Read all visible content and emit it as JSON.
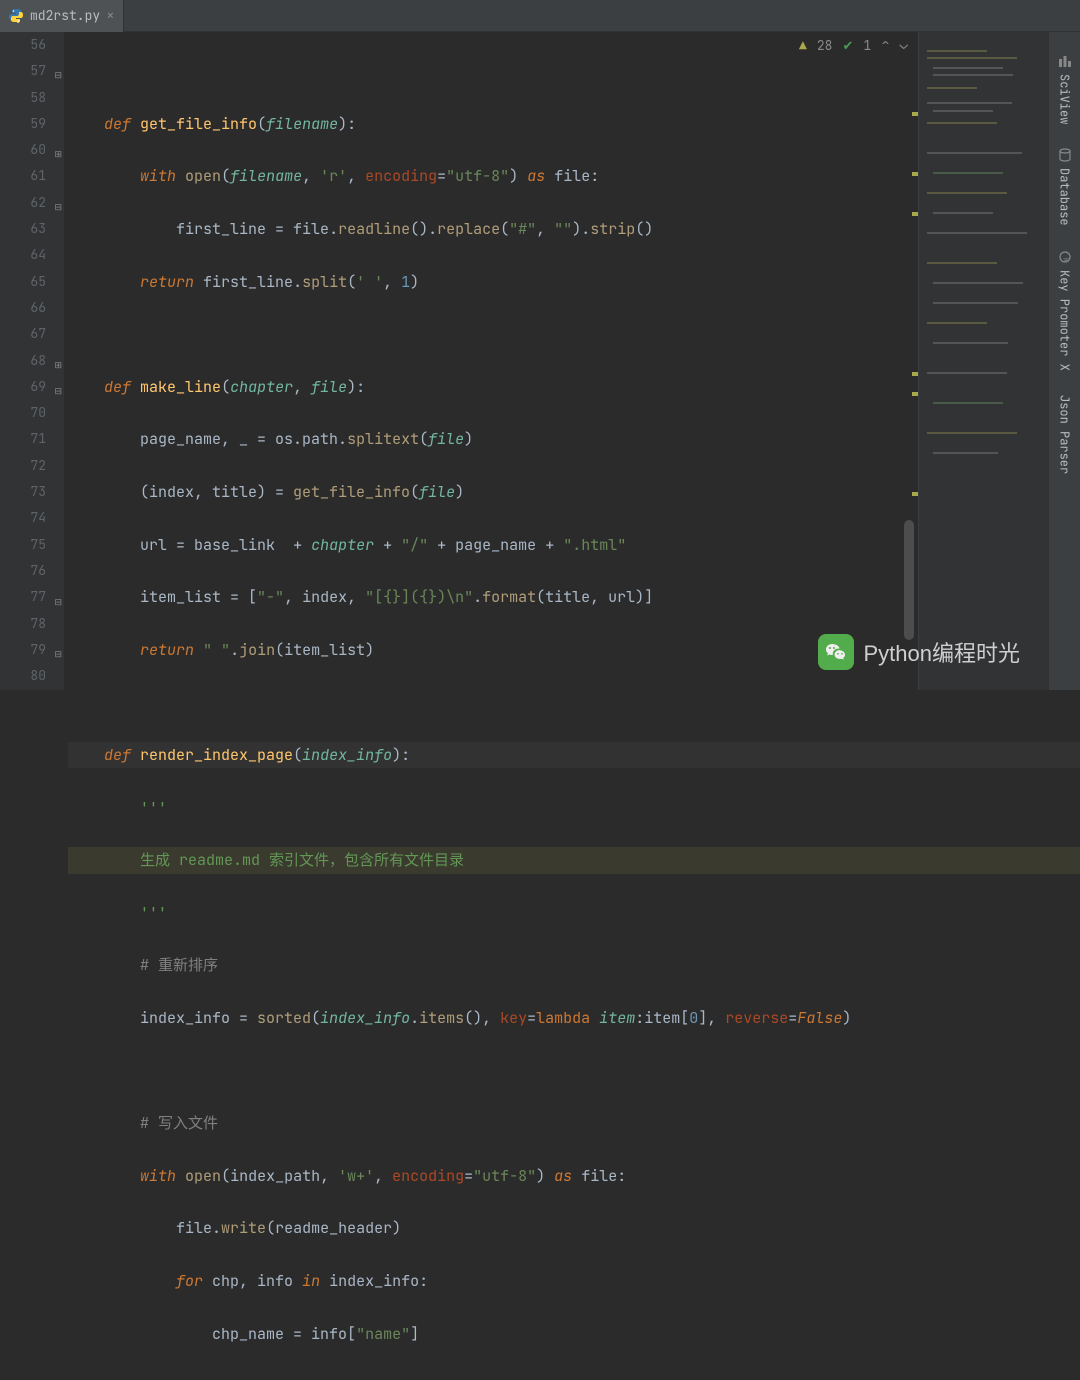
{
  "tab": {
    "filename": "md2rst.py",
    "close": "×"
  },
  "inspections": {
    "warnings": "28",
    "passes": "1"
  },
  "tools": {
    "sciview": "SciView",
    "database": "Database",
    "keypromoter": "Key Promoter X",
    "jsonparser": "Json Parser"
  },
  "watermark": "Python编程时光",
  "gutter": [
    "56",
    "57",
    "58",
    "59",
    "60",
    "61",
    "62",
    "63",
    "64",
    "65",
    "66",
    "67",
    "68",
    "69",
    "70",
    "71",
    "72",
    "73",
    "74",
    "75",
    "76",
    "77",
    "78",
    "79",
    "80"
  ],
  "code": {
    "l56": "",
    "l57": {
      "pre": "    ",
      "def": "def",
      "sp": " ",
      "fn": "get_file_info",
      "p1": "(",
      "param": "filename",
      "p2": "):"
    },
    "l58": {
      "pre": "        ",
      "with": "with",
      "sp": " ",
      "open": "open",
      "p1": "(",
      "arg": "filename",
      "c": ", ",
      "s1": "'r'",
      "c2": ", ",
      "kw": "encoding",
      "eq": "=",
      "s2": "\"utf-8\"",
      "p2": ") ",
      "as": "as",
      "sp2": " ",
      "f": "file",
      "p3": ":"
    },
    "l59": {
      "pre": "            ",
      "v": "first_line ",
      "eq": "= ",
      "f": "file",
      "dot": ".",
      "m1": "readline",
      "p1": "().",
      "m2": "replace",
      "p2": "(",
      "s1": "\"#\"",
      "c": ", ",
      "s2": "\"\"",
      "p3": ").",
      "m3": "strip",
      "p4": "()"
    },
    "l60": {
      "pre": "        ",
      "ret": "return",
      "sp": " ",
      "v": "first_line",
      "dot": ".",
      "m": "split",
      "p1": "(",
      "s": "' '",
      "c": ", ",
      "n": "1",
      "p2": ")"
    },
    "l61": "",
    "l62": {
      "pre": "    ",
      "def": "def",
      "sp": " ",
      "fn": "make_line",
      "p1": "(",
      "a1": "chapter",
      "c": ", ",
      "a2": "file",
      "p2": "):"
    },
    "l63": {
      "pre": "        ",
      "v": "page_name, _ ",
      "eq": "= ",
      "m": "os.path.",
      "fn": "splitext",
      "p1": "(",
      "a": "file",
      "p2": ")"
    },
    "l64": {
      "pre": "        ",
      "v": "(index, title) ",
      "eq": "= ",
      "fn": "get_file_info",
      "p1": "(",
      "a": "file",
      "p2": ")"
    },
    "l65": {
      "pre": "        ",
      "v": "url ",
      "eq": "= ",
      "v2": "base_link  ",
      "plus": "+ ",
      "a": "chapter",
      "sp": " ",
      "plus2": "+ ",
      "s1": "\"/\"",
      "sp2": " ",
      "plus3": "+ ",
      "v3": "page_name ",
      "plus4": "+ ",
      "s2": "\".html\""
    },
    "l66": {
      "pre": "        ",
      "v": "item_list ",
      "eq": "= [",
      "s1": "\"-\"",
      "c1": ", ",
      "v2": "index",
      "c2": ", ",
      "s2": "\"[{}]({})\\n\"",
      "dot": ".",
      "fn": "format",
      "p1": "(title, url)]"
    },
    "l67": {
      "pre": "        ",
      "ret": "return",
      "sp": " ",
      "s": "\" \"",
      "dot": ".",
      "fn": "join",
      "p": "(item_list)"
    },
    "l68": "",
    "l69": {
      "pre": "    ",
      "def": "def",
      "sp": " ",
      "fn": "render_index_page",
      "p1": "(",
      "a": "index_info",
      "p2": "):"
    },
    "l70": {
      "pre": "        ",
      "doc": "'''"
    },
    "l71": {
      "pre": "        ",
      "doc": "生成 readme.md 索引文件，包含所有文件目录"
    },
    "l72": {
      "pre": "        ",
      "doc": "'''"
    },
    "l73": {
      "pre": "        ",
      "c": "# 重新排序"
    },
    "l74": {
      "pre": "        ",
      "v": "index_info ",
      "eq": "= ",
      "fn": "sorted",
      "p1": "(",
      "a": "index_info",
      "dot": ".",
      "m": "items",
      "p2": "(), ",
      "kw1": "key",
      "eq2": "=",
      "lam": "lambda",
      "sp": " ",
      "la": "item",
      "col": ":",
      "v2": "item[",
      "n": "0",
      "b": "], ",
      "kw2": "reverse",
      "eq3": "=",
      "false": "False",
      "p3": ")"
    },
    "l75": "",
    "l76": {
      "pre": "        ",
      "c": "# 写入文件"
    },
    "l77": {
      "pre": "        ",
      "with": "with",
      "sp": " ",
      "fn": "open",
      "p1": "(index_path, ",
      "s1": "'w+'",
      "c": ", ",
      "kw": "encoding",
      "eq": "=",
      "s2": "\"utf-8\"",
      "p2": ") ",
      "as": "as",
      "sp2": " ",
      "f": "file",
      "p3": ":"
    },
    "l78": {
      "pre": "            ",
      "v": "file",
      "dot": ".",
      "fn": "write",
      "p": "(readme_header)"
    },
    "l79": {
      "pre": "            ",
      "for": "for",
      "sp": " ",
      "v": "chp, info ",
      "in": "in",
      "sp2": " ",
      "v2": "index_info",
      "p": ":"
    },
    "l80": {
      "pre": "                ",
      "v": "chp_name ",
      "eq": "= ",
      "v2": "info[",
      "s": "\"name\"",
      "b": "]"
    }
  }
}
